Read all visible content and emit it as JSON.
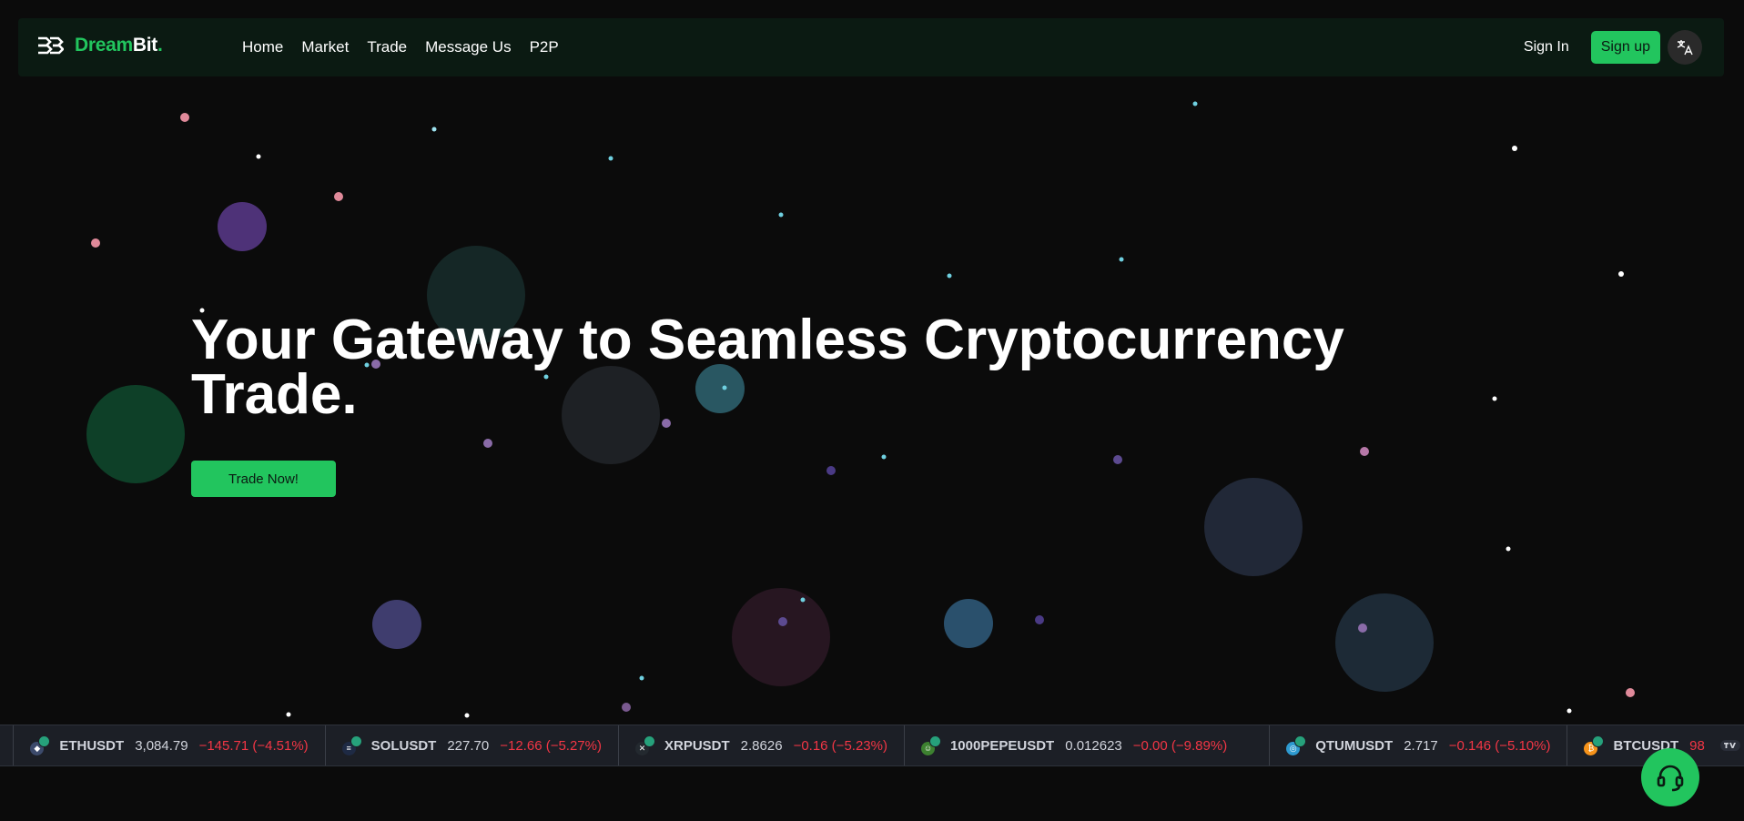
{
  "brand": {
    "name_a": "Dream",
    "name_b": "Bit",
    "dot": "."
  },
  "nav": {
    "links": [
      "Home",
      "Market",
      "Trade",
      "Message Us",
      "P2P"
    ],
    "signin": "Sign In",
    "signup": "Sign up",
    "language_icon": "translate-icon"
  },
  "hero": {
    "title_line1": "Your Gateway to Seamless Cryptocurrency",
    "title_line2": "Trade.",
    "cta": "Trade Now!"
  },
  "ticker": {
    "leading_fragment": "%)",
    "items": [
      {
        "symbol": "ETHUSDT",
        "price": "3,084.79",
        "change": "−145.71 (−4.51%)",
        "coin_color": "#627eea",
        "coin_glyph": "◆"
      },
      {
        "symbol": "SOLUSDT",
        "price": "227.70",
        "change": "−12.66 (−5.27%)",
        "coin_color": "#1e2a44",
        "coin_glyph": "≡"
      },
      {
        "symbol": "XRPUSDT",
        "price": "2.8626",
        "change": "−0.16 (−5.23%)",
        "coin_color": "#23292f",
        "coin_glyph": "✕"
      },
      {
        "symbol": "1000PEPEUSDT",
        "price": "0.012623",
        "change": "−0.00 (−9.89%)",
        "coin_color": "#3d8130",
        "coin_glyph": "☺"
      },
      {
        "symbol": "QTUMUSDT",
        "price": "2.717",
        "change": "−0.146 (−5.10%)",
        "coin_color": "#2e9ad0",
        "coin_glyph": "◎"
      },
      {
        "symbol": "BTCUSDT",
        "price": "98",
        "change": "",
        "coin_color": "#f7931a",
        "coin_glyph": "₿"
      }
    ],
    "logo_icon": "tradingview-icon"
  },
  "support": {
    "icon": "headset-icon"
  },
  "colors": {
    "accent": "#22c55e",
    "background": "#0b0b0b",
    "navbar": "#0b1a12",
    "negative": "#f23645"
  }
}
